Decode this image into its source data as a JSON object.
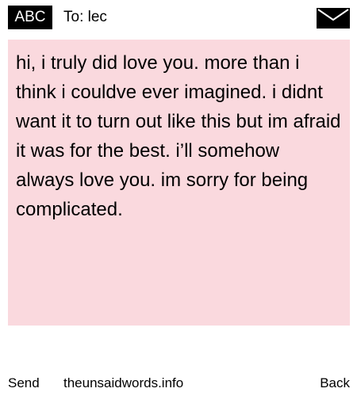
{
  "header": {
    "input_mode": "ABC",
    "recipient": "To: lec",
    "icon": "envelope-icon"
  },
  "message": {
    "text": "hi, i truly did love you. more than i think i couldve ever imagined. i didnt want it to turn out like this but im afraid it was for the best. i’ll somehow always love you. im sorry for being complicated.",
    "background_color": "#fad9de"
  },
  "footer": {
    "send_label": "Send",
    "site": "theunsaidwords.info",
    "back_label": "Back"
  }
}
